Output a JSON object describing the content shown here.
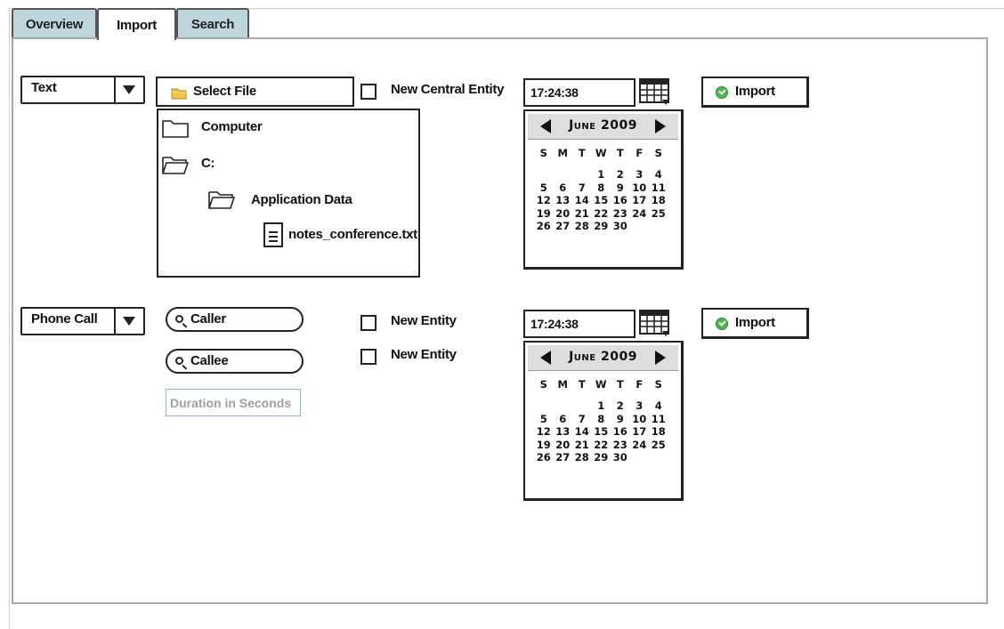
{
  "tabs": [
    {
      "label": "Overview",
      "active": false
    },
    {
      "label": "Import",
      "active": true
    },
    {
      "label": "Search",
      "active": false
    }
  ],
  "row1": {
    "type_select": {
      "value": "Text"
    },
    "select_file": {
      "label": "Select File",
      "icon": "folder-icon"
    },
    "file_tree": {
      "items": [
        {
          "label": "Computer",
          "icon": "folder-icon"
        },
        {
          "label": "C:",
          "icon": "folder-open-icon"
        },
        {
          "label": "Application Data",
          "icon": "folder-open-icon"
        },
        {
          "label": "notes_conference.txt",
          "icon": "file-icon"
        }
      ]
    },
    "checkbox": {
      "label": "New Central Entity",
      "checked": false
    },
    "time": "17:24:38",
    "calendar": {
      "month": "June 2009",
      "weekdays": [
        "S",
        "M",
        "T",
        "W",
        "T",
        "F",
        "S"
      ],
      "weeks": [
        [
          "",
          "",
          "",
          "1",
          "2",
          "3",
          "4"
        ],
        [
          "5",
          "6",
          "7",
          "8",
          "9",
          "10",
          "11"
        ],
        [
          "12",
          "13",
          "14",
          "15",
          "16",
          "17",
          "18"
        ],
        [
          "19",
          "20",
          "21",
          "22",
          "23",
          "24",
          "25"
        ],
        [
          "26",
          "27",
          "28",
          "29",
          "30",
          "",
          ""
        ]
      ]
    },
    "import_button": "Import"
  },
  "row2": {
    "type_select": {
      "value": "Phone Call"
    },
    "caller": {
      "label": "Caller",
      "icon": "search-icon"
    },
    "callee": {
      "label": "Callee",
      "icon": "search-icon"
    },
    "duration": {
      "placeholder": "Duration in Seconds"
    },
    "checkboxes": [
      {
        "label": "New Entity",
        "checked": false
      },
      {
        "label": "New Entity",
        "checked": false
      }
    ],
    "time": "17:24:38",
    "calendar": {
      "month": "June 2009",
      "weekdays": [
        "S",
        "M",
        "T",
        "W",
        "T",
        "F",
        "S"
      ],
      "weeks": [
        [
          "",
          "",
          "",
          "1",
          "2",
          "3",
          "4"
        ],
        [
          "5",
          "6",
          "7",
          "8",
          "9",
          "10",
          "11"
        ],
        [
          "12",
          "13",
          "14",
          "15",
          "16",
          "17",
          "18"
        ],
        [
          "19",
          "20",
          "21",
          "22",
          "23",
          "24",
          "25"
        ],
        [
          "26",
          "27",
          "28",
          "29",
          "30",
          "",
          ""
        ]
      ]
    },
    "import_button": "Import"
  },
  "colors": {
    "tab_inactive": "#bcd6dc",
    "panel_border": "#a8a8a8",
    "ok_green": "#4cb84c",
    "folder_yellow": "#f4c542",
    "duration_border": "#8fb2e0"
  }
}
